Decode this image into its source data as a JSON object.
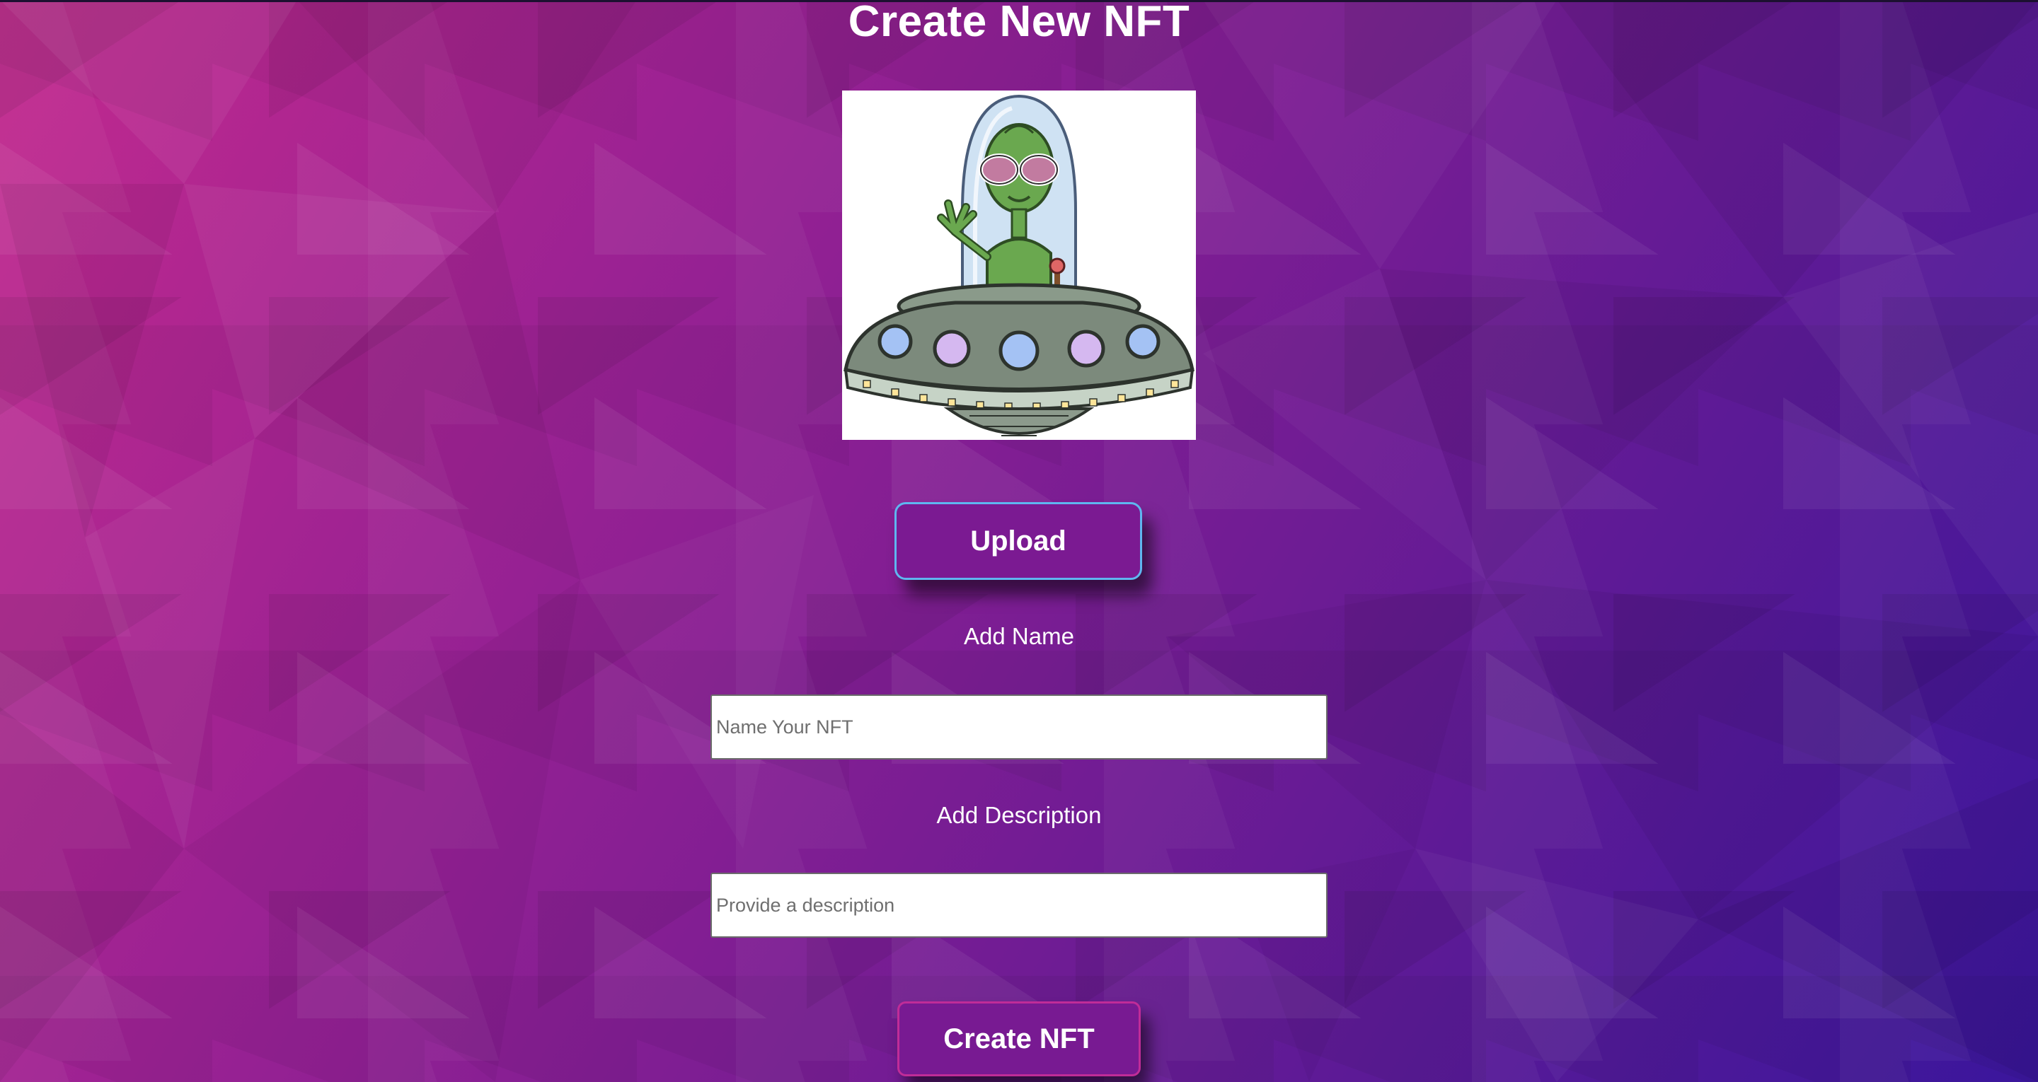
{
  "page": {
    "title": "Create New NFT"
  },
  "preview": {
    "image_subject": "alien-in-ufo-illustration"
  },
  "upload": {
    "label": "Upload"
  },
  "name_field": {
    "label": "Add Name",
    "placeholder": "Name Your NFT",
    "value": ""
  },
  "description_field": {
    "label": "Add Description",
    "placeholder": "Provide a description",
    "value": ""
  },
  "create": {
    "label": "Create NFT"
  },
  "colors": {
    "background_start": "#c22a8e",
    "background_end": "#3a169c",
    "upload_border": "#5fb6f0",
    "create_border": "#c02c98",
    "button_fill": "#7b1a92"
  }
}
